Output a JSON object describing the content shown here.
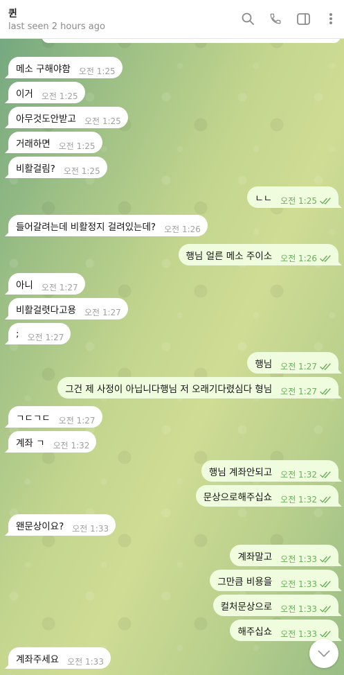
{
  "header": {
    "name": "퀸",
    "status": "last seen 2 hours ago",
    "icons": [
      "search-icon",
      "phone-icon",
      "sidebar-toggle-icon",
      "more-vert-icon"
    ]
  },
  "colors": {
    "incoming_bubble": "#ffffff",
    "outgoing_bubble": "#effdde",
    "outgoing_time": "#6aae5b",
    "incoming_time": "#a0a0a0"
  },
  "messages": [
    {
      "dir": "in",
      "text": "메소 구해야함",
      "time": "오전 1:25"
    },
    {
      "dir": "in",
      "text": "이거",
      "time": "오전 1:25"
    },
    {
      "dir": "in",
      "text": "아무것도안받고",
      "time": "오전 1:25"
    },
    {
      "dir": "in",
      "text": "거래하면",
      "time": "오전 1:25"
    },
    {
      "dir": "in",
      "text": "비활걸림?",
      "time": "오전 1:25"
    },
    {
      "dir": "out",
      "text": "ㄴㄴ",
      "time": "오전 1:25"
    },
    {
      "dir": "in",
      "text": "들어갈려는데 비활정지 걸려있는데?",
      "time": "오전 1:26"
    },
    {
      "dir": "out",
      "text": "행님 얼른 메소 주이소",
      "time": "오전 1:26"
    },
    {
      "dir": "in",
      "text": "아니",
      "time": "오전 1:27"
    },
    {
      "dir": "in",
      "text": "비활걸렷다고용",
      "time": "오전 1:27"
    },
    {
      "dir": "in",
      "text": ";",
      "time": "오전 1:27"
    },
    {
      "dir": "out",
      "text": "행님",
      "time": "오전 1:27"
    },
    {
      "dir": "out",
      "text": "그건 제 사정이 아닙니다행님 저 오래기다렸심다 형님",
      "time": "오전 1:27"
    },
    {
      "dir": "in",
      "text": "ㄱㄷㄱㄷ",
      "time": "오전 1:27"
    },
    {
      "dir": "in",
      "text": "계좌 ㄱ",
      "time": "오전 1:32"
    },
    {
      "dir": "out",
      "text": "행님 계좌안되고",
      "time": "오전 1:32"
    },
    {
      "dir": "out",
      "text": "문상으로해주십쇼",
      "time": "오전 1:32"
    },
    {
      "dir": "in",
      "text": "왠문상이요?",
      "time": "오전 1:33"
    },
    {
      "dir": "out",
      "text": "계좌말고",
      "time": "오전 1:33"
    },
    {
      "dir": "out",
      "text": "그만큼 비용을",
      "time": "오전 1:33"
    },
    {
      "dir": "out",
      "text": "컬처문상으로",
      "time": "오전 1:33"
    },
    {
      "dir": "out",
      "text": "해주십쇼",
      "time": "오전 1:33"
    },
    {
      "dir": "in",
      "text": "계좌주세요",
      "time": "오전 1:33"
    }
  ]
}
